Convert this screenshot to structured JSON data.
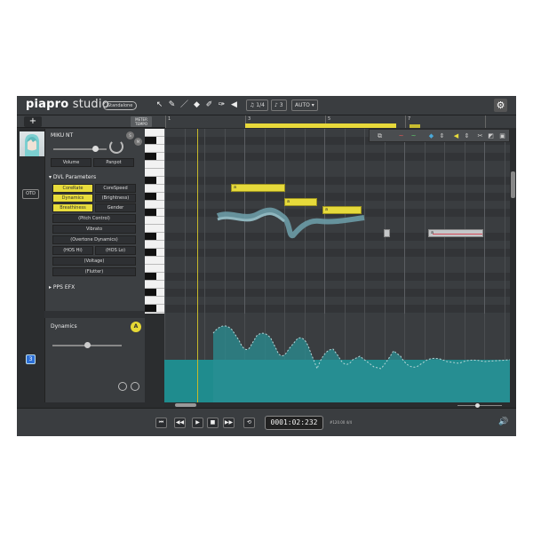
{
  "app": {
    "logo_piapro": "piapro",
    "logo_studio": " studio",
    "edition": "Standalone"
  },
  "toolbar": {
    "tools": [
      "cursor-arrow-icon",
      "pencil-icon",
      "line-icon",
      "eraser-icon",
      "brush-icon",
      "erase-brush-icon",
      "speaker-icon"
    ],
    "quantize": "1/4",
    "length": "3",
    "auto": "AUTO"
  },
  "track": {
    "add_label": "+",
    "meter_label": "METER TEMPO",
    "otd_label": "OTD",
    "track_number": "3",
    "ruler_numbers": [
      "1",
      "3",
      "5",
      "7"
    ]
  },
  "singer_panel": {
    "singer_name": "MIKU NT",
    "solo": "S",
    "mute": "M",
    "volume_label": "Volume",
    "panpot_label": "Panpot",
    "volume_level": 0.8,
    "dvl_title": "DVL Parameters",
    "params": [
      {
        "label": "CoreRate",
        "active": true
      },
      {
        "label": "CoreSpeed",
        "active": false
      },
      {
        "label": "Dynamics",
        "active": true
      },
      {
        "label": "(Brightness)",
        "active": false
      },
      {
        "label": "Breathiness",
        "active": true
      },
      {
        "label": "Gender",
        "active": false
      }
    ],
    "full_params": [
      "(Pitch Control)",
      "Vibrato",
      "(Overtone Dynamics)"
    ],
    "hos_hi": "(HOS Hi)",
    "hos_lo": "(HOS Lo)",
    "voltage": "(Voltage)",
    "flutter": "(Flutter)",
    "pps_title": "PPS EFX"
  },
  "dynamics_panel": {
    "title": "Dynamics",
    "badge": "A",
    "level": 0.5
  },
  "notes": [
    {
      "lyric": "a",
      "color": "yellow"
    },
    {
      "lyric": "a",
      "color": "yellow"
    },
    {
      "lyric": "a",
      "color": "yellow"
    },
    {
      "lyric": "",
      "color": "gray"
    },
    {
      "lyric": "a",
      "color": "gray"
    }
  ],
  "transport": {
    "time": "0001:02:232",
    "tempo": "#120.00   4/4"
  },
  "colors": {
    "accent_yellow": "#e6da3b",
    "dynamics_teal": "#1f8c8e",
    "pitch_curve": "#6b9ba6",
    "track_blue": "#2d6fd6"
  }
}
